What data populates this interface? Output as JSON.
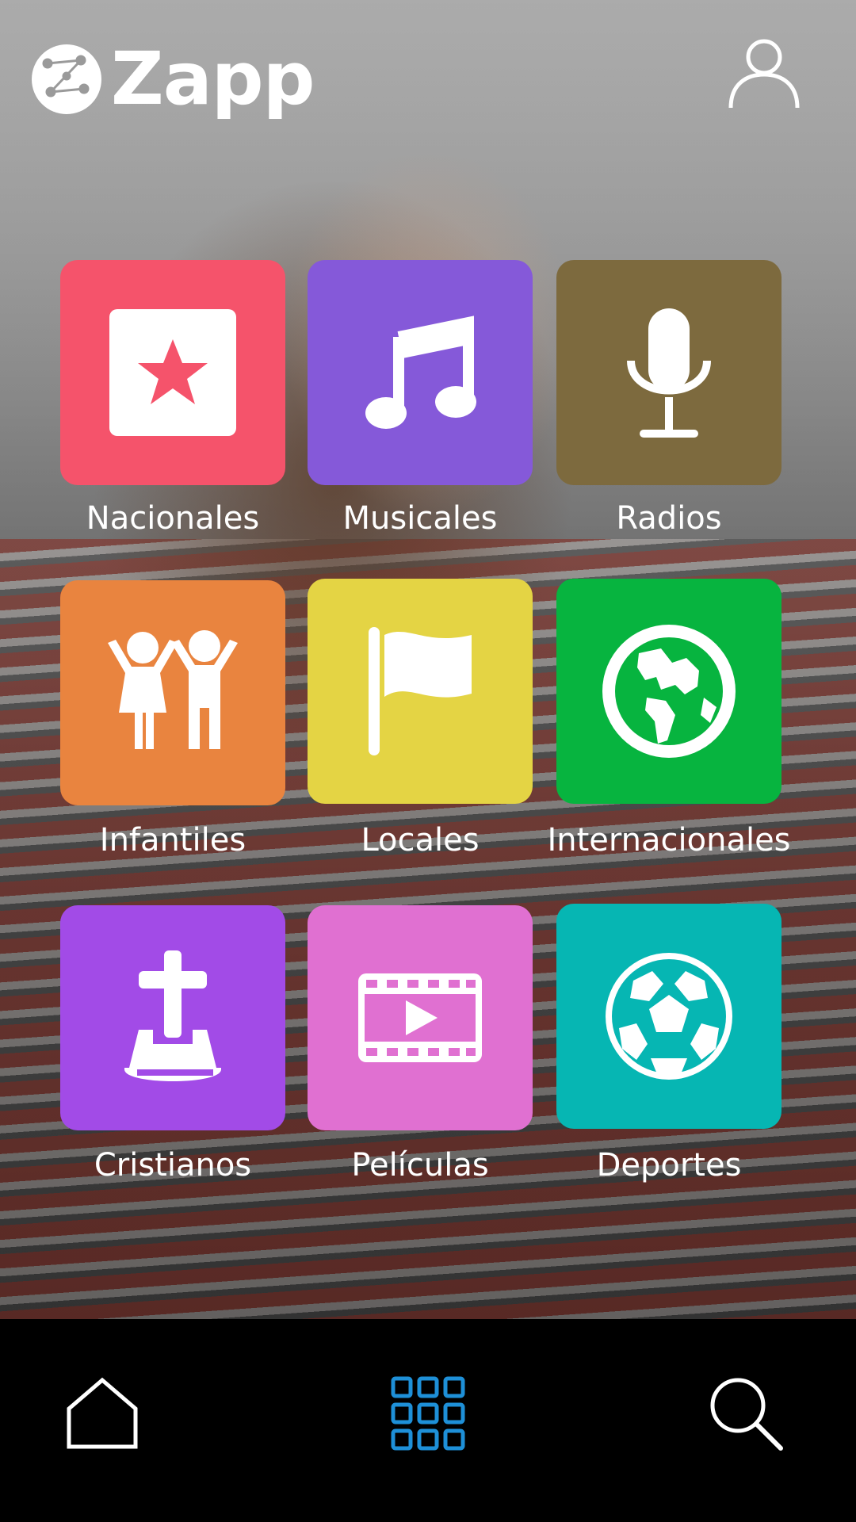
{
  "header": {
    "app_name": "Zapp",
    "user_icon": "user-icon"
  },
  "colors": {
    "nacionales": "#F5536B",
    "musicales": "#8559D9",
    "radios": "#7D6A3E",
    "infantiles": "#E9843F",
    "locales": "#E4D444",
    "internacionales": "#07B43F",
    "cristianos": "#A24BE7",
    "peliculas": "#E070D1",
    "deportes": "#06B6B3",
    "nav_active": "#1E90D8",
    "nav_inactive": "#FFFFFF"
  },
  "categories": [
    {
      "label": "Nacionales",
      "icon": "star-icon"
    },
    {
      "label": "Musicales",
      "icon": "music-note-icon"
    },
    {
      "label": "Radios",
      "icon": "microphone-icon"
    },
    {
      "label": "Infantiles",
      "icon": "children-icon"
    },
    {
      "label": "Locales",
      "icon": "flag-icon"
    },
    {
      "label": "Internacionales",
      "icon": "globe-icon"
    },
    {
      "label": "Cristianos",
      "icon": "cross-bible-icon"
    },
    {
      "label": "Películas",
      "icon": "film-icon"
    },
    {
      "label": "Deportes",
      "icon": "soccer-ball-icon"
    }
  ],
  "bottom_nav": {
    "items": [
      {
        "icon": "home-icon",
        "active": false
      },
      {
        "icon": "grid-icon",
        "active": true
      },
      {
        "icon": "search-icon",
        "active": false
      }
    ]
  }
}
